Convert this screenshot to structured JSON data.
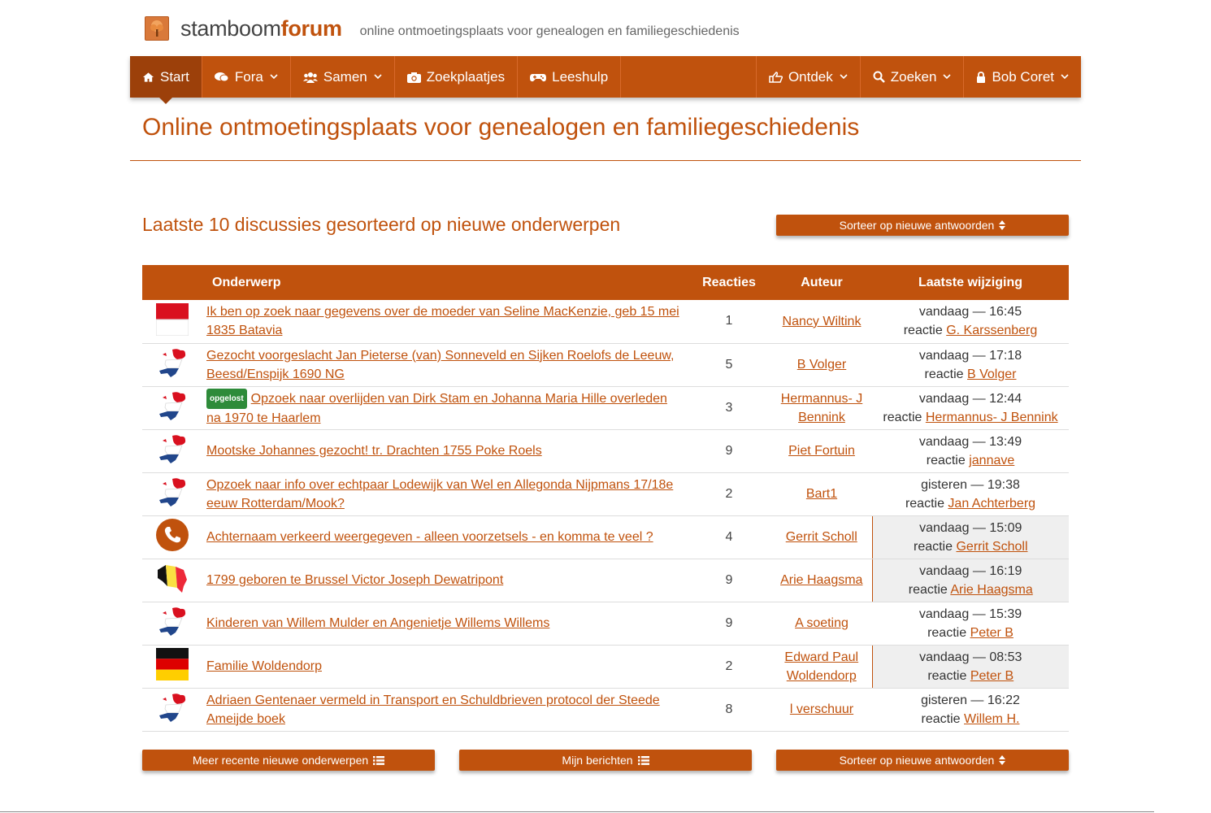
{
  "site": {
    "brand_plain": "stamboom",
    "brand_bold": "forum",
    "tagline": "online ontmoetingsplaats voor genealogen en familiegeschiedenis"
  },
  "nav": {
    "start": "Start",
    "fora": "Fora",
    "samen": "Samen",
    "zoekplaatjes": "Zoekplaatjes",
    "leeshulp": "Leeshulp",
    "ontdek": "Ontdek",
    "zoeken": "Zoeken",
    "user": "Bob Coret"
  },
  "page_title": "Online ontmoetingsplaats voor genealogen en familiegeschiedenis",
  "section_title": "Laatste 10 discussies gesorteerd op nieuwe onderwerpen",
  "buttons": {
    "sort_top": "Sorteer op nieuwe antwoorden",
    "more_recent": "Meer recente nieuwe onderwerpen",
    "my_posts": "Mijn berichten",
    "sort_bottom": "Sorteer op nieuwe antwoorden"
  },
  "table": {
    "headers": {
      "topic": "Onderwerp",
      "reactions": "Reacties",
      "author": "Auteur",
      "last": "Laatste wijziging"
    },
    "reply_prefix": "reactie",
    "solved_badge": "opgelost",
    "rows": [
      {
        "flag": "indonesia",
        "title": "Ik ben op zoek naar gegevens over de moeder van Seline MacKenzie, geb 15 mei 1835 Batavia",
        "reactions": "1",
        "author": "Nancy Wiltink",
        "when": "vandaag — 16:45",
        "reply_by": "G. Karssenberg",
        "highlight": false,
        "solved": false
      },
      {
        "flag": "netherlands",
        "title": "Gezocht voorgeslacht Jan Pieterse (van) Sonneveld en Sijken Roelofs de Leeuw, Beesd/Enspijk 1690 NG",
        "reactions": "5",
        "author": "B Volger",
        "when": "vandaag — 17:18",
        "reply_by": "B Volger",
        "highlight": false,
        "solved": false
      },
      {
        "flag": "netherlands",
        "title": "Opzoek naar overlijden van Dirk Stam en Johanna Maria Hille overleden na 1970 te Haarlem",
        "reactions": "3",
        "author": "Hermannus- J Bennink",
        "when": "vandaag — 12:44",
        "reply_by": "Hermannus- J Bennink",
        "highlight": false,
        "solved": true
      },
      {
        "flag": "netherlands",
        "title": "Mootske Johannes gezocht! tr. Drachten 1755 Poke Roels",
        "reactions": "9",
        "author": "Piet Fortuin",
        "when": "vandaag — 13:49",
        "reply_by": "jannave",
        "highlight": false,
        "solved": false
      },
      {
        "flag": "netherlands",
        "title": "Opzoek naar info over echtpaar Lodewijk van Wel en Allegonda Nijpmans 17/18e eeuw Rotterdam/Mook?",
        "reactions": "2",
        "author": "Bart1",
        "when": "gisteren — 19:38",
        "reply_by": "Jan Achterberg",
        "highlight": false,
        "solved": false
      },
      {
        "flag": "phone",
        "title": "Achternaam verkeerd weergegeven - alleen voorzetsels - en komma te veel ?",
        "reactions": "4",
        "author": "Gerrit Scholl",
        "when": "vandaag — 15:09",
        "reply_by": "Gerrit Scholl",
        "highlight": true,
        "solved": false
      },
      {
        "flag": "belgium",
        "title": "1799 geboren te Brussel Victor Joseph Dewatripont",
        "reactions": "9",
        "author": "Arie Haagsma",
        "when": "vandaag — 16:19",
        "reply_by": "Arie Haagsma",
        "highlight": true,
        "solved": false
      },
      {
        "flag": "netherlands",
        "title": "Kinderen van Willem Mulder en Angenietje Willems Willems",
        "reactions": "9",
        "author": "A soeting",
        "when": "vandaag — 15:39",
        "reply_by": "Peter B",
        "highlight": false,
        "solved": false
      },
      {
        "flag": "germany",
        "title": "Familie Woldendorp",
        "reactions": "2",
        "author": "Edward Paul Woldendorp",
        "when": "vandaag — 08:53",
        "reply_by": "Peter B",
        "highlight": true,
        "solved": false
      },
      {
        "flag": "netherlands",
        "title": "Adriaen Gentenaer vermeld in Transport en Schuldbrieven protocol der Steede Ameijde boek",
        "reactions": "8",
        "author": "l verschuur",
        "when": "gisteren — 16:22",
        "reply_by": "Willem H.",
        "highlight": false,
        "solved": false
      }
    ]
  },
  "colors": {
    "accent": "#c0520d",
    "accent_dark": "#9c400a",
    "solved_green": "#2e8b3a",
    "highlight_bg": "#efefef"
  }
}
